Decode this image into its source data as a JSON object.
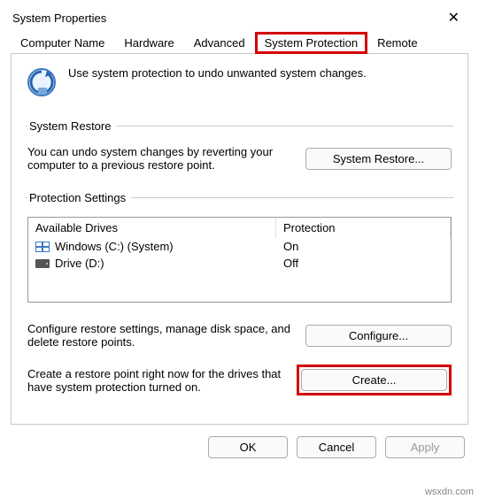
{
  "window": {
    "title": "System Properties"
  },
  "tabs": [
    {
      "label": "Computer Name"
    },
    {
      "label": "Hardware"
    },
    {
      "label": "Advanced"
    },
    {
      "label": "System Protection"
    },
    {
      "label": "Remote"
    }
  ],
  "intro": {
    "text": "Use system protection to undo unwanted system changes."
  },
  "system_restore": {
    "legend": "System Restore",
    "desc": "You can undo system changes by reverting your computer to a previous restore point.",
    "button": "System Restore..."
  },
  "protection_settings": {
    "legend": "Protection Settings",
    "headers": {
      "drives": "Available Drives",
      "protection": "Protection"
    },
    "rows": [
      {
        "icon": "windows",
        "name": "Windows (C:) (System)",
        "protection": "On"
      },
      {
        "icon": "drive",
        "name": "Drive (D:)",
        "protection": "Off"
      }
    ],
    "configure": {
      "desc": "Configure restore settings, manage disk space, and delete restore points.",
      "button": "Configure..."
    },
    "create": {
      "desc": "Create a restore point right now for the drives that have system protection turned on.",
      "button": "Create..."
    }
  },
  "dialog_buttons": {
    "ok": "OK",
    "cancel": "Cancel",
    "apply": "Apply"
  },
  "watermark": "wsxdn.com"
}
